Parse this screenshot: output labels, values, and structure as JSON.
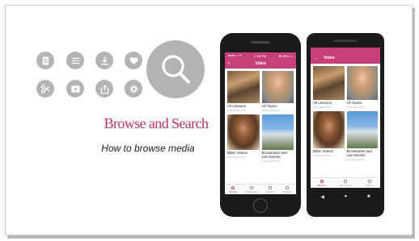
{
  "slide": {
    "title": "Browse and Search",
    "subtitle": "How to browse media"
  },
  "icons": [
    {
      "name": "document-icon"
    },
    {
      "name": "list-icon"
    },
    {
      "name": "download-icon"
    },
    {
      "name": "heart-icon"
    },
    {
      "name": "scissors-icon"
    },
    {
      "name": "video-icon"
    },
    {
      "name": "share-icon"
    },
    {
      "name": "gear-icon"
    },
    {
      "name": "search-icon"
    }
  ],
  "iphone": {
    "status_left": "●●●○○ ᯤ",
    "status_time": "2:38 PM",
    "status_right": "✱ 94% ▭",
    "header": "Video",
    "back": "‹",
    "tiles": [
      {
        "label": "All Lessons",
        "sub": "COLLECTION"
      },
      {
        "label": "All Topics",
        "sub": "COLLECTION"
      },
      {
        "label": "Bible Videos",
        "sub": "COLLECTION"
      },
      {
        "label": "Broadcasts and Live Events",
        "sub": "COLLECTION"
      }
    ],
    "tabs": [
      "Browse",
      "Bookmarks",
      "Search",
      "Settings"
    ]
  },
  "android": {
    "header": "Video",
    "back": "←",
    "tiles": [
      {
        "label": "All Lessons",
        "sub": "COLLECTION"
      },
      {
        "label": "All Topics",
        "sub": "COLLECTION"
      },
      {
        "label": "Bible Videos",
        "sub": "COLLECTION"
      },
      {
        "label": "Broadcasts and Live Events",
        "sub": "COLLECTION"
      }
    ],
    "tabs": [
      "Browse",
      "Bookmarks",
      "Search"
    ],
    "nav": [
      "◀",
      "●",
      "■"
    ]
  },
  "colors": {
    "accent": "#b8336a",
    "icon_circle": "#b4b4b4",
    "app_header": "#c8407a"
  }
}
